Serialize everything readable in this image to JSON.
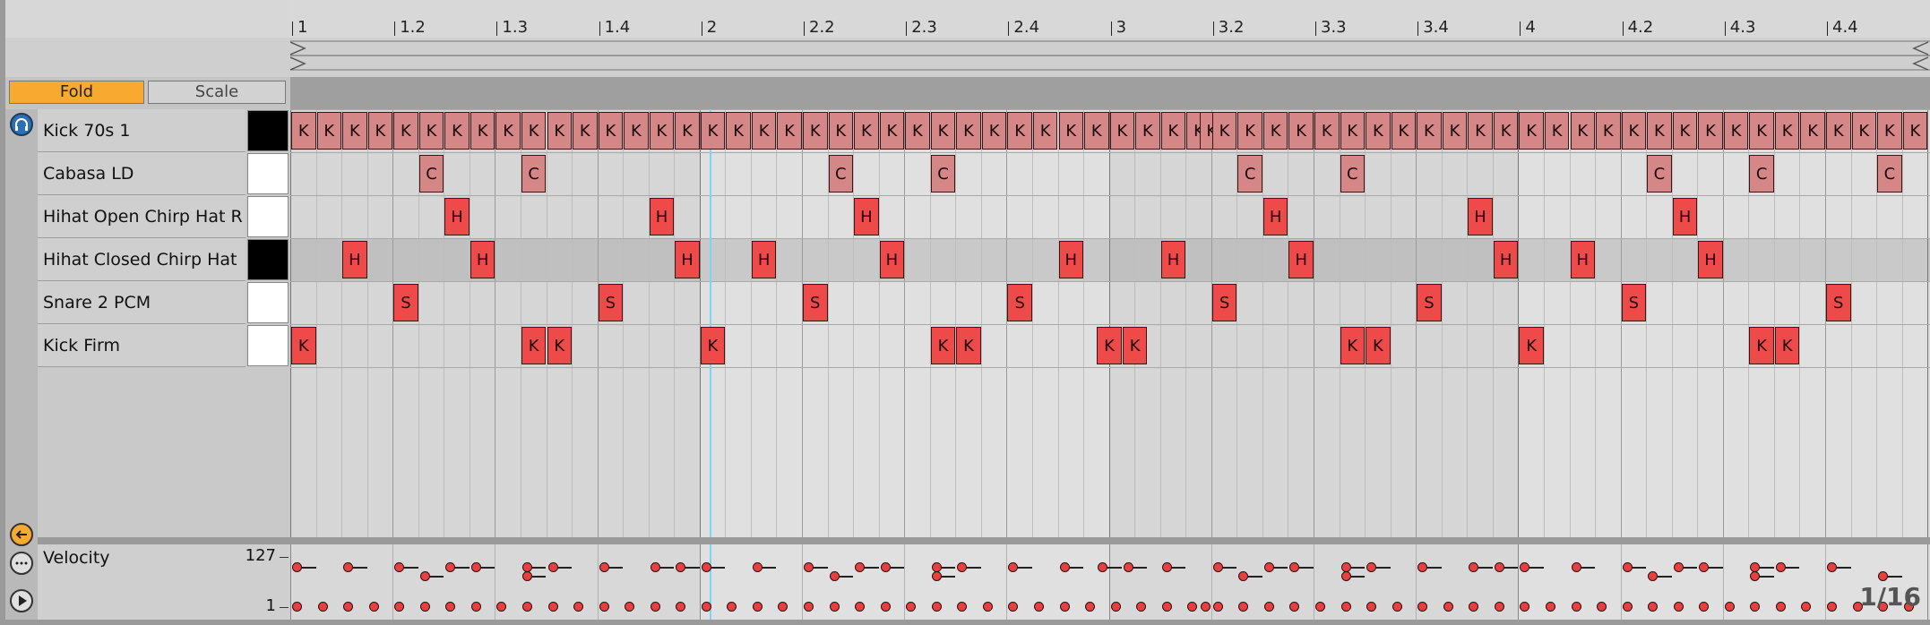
{
  "toolbar": {
    "fold_label": "Fold",
    "scale_label": "Scale"
  },
  "ruler": {
    "labels": [
      "1",
      "1.2",
      "1.3",
      "1.4",
      "2",
      "2.2",
      "2.3",
      "2.4",
      "3",
      "3.2",
      "3.3",
      "3.4",
      "4",
      "4.2",
      "4.3",
      "4.4"
    ]
  },
  "rows": [
    {
      "name": "Kick 70s 1",
      "pad": "black",
      "shaded": false
    },
    {
      "name": "Cabasa LD",
      "pad": "white",
      "shaded": false
    },
    {
      "name": "Hihat Open Chirp Hat R",
      "pad": "white",
      "shaded": false
    },
    {
      "name": "Hihat Closed Chirp Hat",
      "pad": "black",
      "shaded": true
    },
    {
      "name": "Snare 2 PCM",
      "pad": "white",
      "shaded": false
    },
    {
      "name": "Kick Firm",
      "pad": "white",
      "shaded": false
    }
  ],
  "notes": {
    "kick70": {
      "letter": "K",
      "steps": [
        0,
        1,
        2,
        3,
        4,
        5,
        6,
        7,
        8,
        9,
        10,
        11,
        12,
        13,
        14,
        15,
        16,
        17,
        18,
        19,
        20,
        21,
        22,
        23,
        24,
        25,
        26,
        27,
        28,
        29,
        30,
        31,
        32,
        33,
        34,
        35,
        35.5,
        36,
        37,
        38,
        39,
        40,
        41,
        42,
        43,
        44,
        45,
        46,
        47,
        48,
        49,
        50,
        51,
        52,
        53,
        54,
        55,
        56,
        57,
        58,
        59,
        60,
        61,
        62,
        63
      ]
    },
    "cabasa": {
      "letter": "C",
      "steps": [
        5,
        9,
        21,
        25,
        37,
        41,
        53,
        57,
        62
      ]
    },
    "hhopen": {
      "letter": "H",
      "steps": [
        6,
        14,
        22,
        38,
        46,
        54
      ]
    },
    "hhclosed": {
      "letter": "H",
      "steps": [
        2,
        7,
        15,
        18,
        23,
        30,
        34,
        39,
        47,
        50,
        55
      ]
    },
    "snare": {
      "letter": "S",
      "steps": [
        4,
        12,
        20,
        28,
        36,
        44,
        52,
        60
      ]
    },
    "kickfirm": {
      "letter": "K",
      "steps": [
        0,
        9,
        10,
        16,
        25,
        26,
        31.5,
        32.5,
        41,
        42,
        48,
        57,
        58
      ]
    }
  },
  "velocity": {
    "label": "Velocity",
    "max_label": "127",
    "min_label": "1",
    "grid_label": "1/16"
  },
  "colors": {
    "accent": "#f8a930",
    "note_bright": "#ee4a4a",
    "note_pale": "#d58787",
    "playhead": "#7fd4f0"
  }
}
